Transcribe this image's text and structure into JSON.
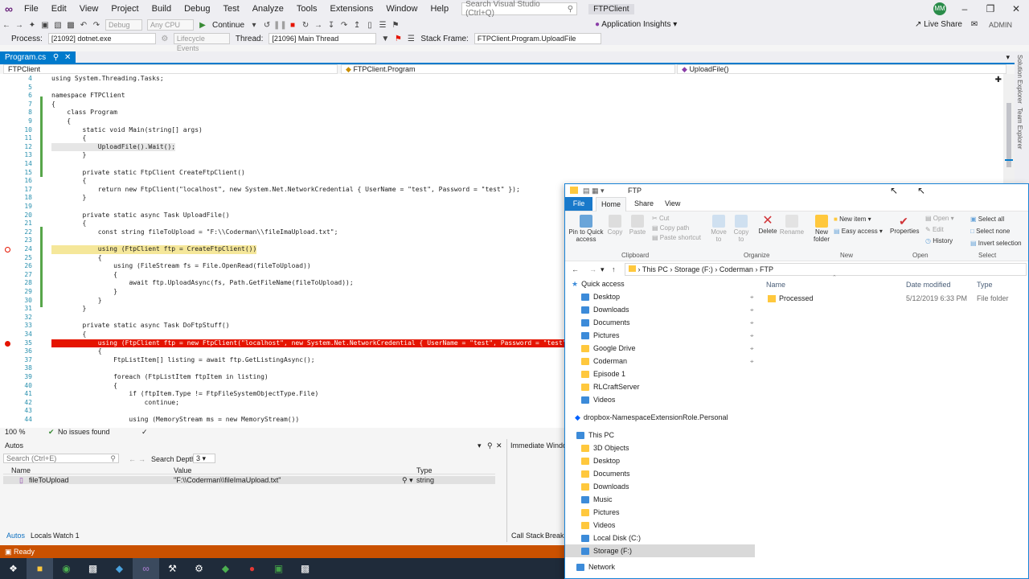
{
  "menubar": {
    "items": [
      "File",
      "Edit",
      "View",
      "Project",
      "Build",
      "Debug",
      "Test",
      "Analyze",
      "Tools",
      "Extensions",
      "Window",
      "Help"
    ],
    "search_placeholder": "Search Visual Studio (Ctrl+Q)",
    "solution_name": "FTPClient",
    "user_initials": "MM"
  },
  "toolbar": {
    "debug_config": "Debug",
    "platform": "Any CPU",
    "continue_label": "Continue",
    "app_insights": "Application Insights",
    "live_share": "Live Share",
    "admin_badge": "ADMIN",
    "process_label": "Process:",
    "process_value": "[21092] dotnet.exe",
    "lifecycle_events": "Lifecycle Events",
    "thread_label": "Thread:",
    "thread_value": "[21096] Main Thread",
    "stack_frame_label": "Stack Frame:",
    "stack_frame_value": "FTPClient.Program.UploadFile"
  },
  "editor": {
    "tab_name": "Program.cs",
    "nav_project": "FTPClient",
    "nav_class": "FTPClient.Program",
    "nav_member": "UploadFile()",
    "zoom": "100 %",
    "issues": "No issues found",
    "lines": [
      {
        "n": "4",
        "text": "using System.Threading.Tasks;"
      },
      {
        "n": "5",
        "text": ""
      },
      {
        "n": "6",
        "text": "namespace FTPClient"
      },
      {
        "n": "7",
        "text": "{"
      },
      {
        "n": "8",
        "text": "    class Program"
      },
      {
        "n": "9",
        "text": "    {"
      },
      {
        "n": "10",
        "text": "        static void Main(string[] args)"
      },
      {
        "n": "11",
        "text": "        {"
      },
      {
        "n": "12",
        "text": "            UploadFile().Wait();"
      },
      {
        "n": "13",
        "text": "        }"
      },
      {
        "n": "14",
        "text": ""
      },
      {
        "n": "15",
        "text": "        private static FtpClient CreateFtpClient()"
      },
      {
        "n": "16",
        "text": "        {"
      },
      {
        "n": "17",
        "text": "            return new FtpClient(\"localhost\", new System.Net.NetworkCredential { UserName = \"test\", Password = \"test\" });"
      },
      {
        "n": "18",
        "text": "        }"
      },
      {
        "n": "19",
        "text": ""
      },
      {
        "n": "20",
        "text": "        private static async Task UploadFile()"
      },
      {
        "n": "21",
        "text": "        {"
      },
      {
        "n": "22",
        "text": "            const string fileToUpload = \"F:\\\\Coderman\\\\fileImaUpload.txt\";"
      },
      {
        "n": "23",
        "text": ""
      },
      {
        "n": "24",
        "text": "            using (FtpClient ftp = CreateFtpClient())"
      },
      {
        "n": "25",
        "text": "            {"
      },
      {
        "n": "26",
        "text": "                using (FileStream fs = File.OpenRead(fileToUpload))"
      },
      {
        "n": "27",
        "text": "                {"
      },
      {
        "n": "28",
        "text": "                    await ftp.UploadAsync(fs, Path.GetFileName(fileToUpload));"
      },
      {
        "n": "29",
        "text": "                }"
      },
      {
        "n": "30",
        "text": "            }"
      },
      {
        "n": "31",
        "text": "        }"
      },
      {
        "n": "32",
        "text": ""
      },
      {
        "n": "33",
        "text": "        private static async Task DoFtpStuff()"
      },
      {
        "n": "34",
        "text": "        {"
      },
      {
        "n": "35",
        "text": "            using (FtpClient ftp = new FtpClient(\"localhost\", new System.Net.NetworkCredential { UserName = \"test\", Password = \"test\" })"
      },
      {
        "n": "36",
        "text": "            {"
      },
      {
        "n": "37",
        "text": "                FtpListItem[] listing = await ftp.GetListingAsync();"
      },
      {
        "n": "38",
        "text": ""
      },
      {
        "n": "39",
        "text": "                foreach (FtpListItem ftpItem in listing)"
      },
      {
        "n": "40",
        "text": "                {"
      },
      {
        "n": "41",
        "text": "                    if (ftpItem.Type != FtpFileSystemObjectType.File)"
      },
      {
        "n": "42",
        "text": "                        continue;"
      },
      {
        "n": "43",
        "text": ""
      },
      {
        "n": "44",
        "text": "                    using (MemoryStream ms = new MemoryStream())"
      }
    ]
  },
  "autos": {
    "title": "Autos",
    "search_placeholder": "Search (Ctrl+E)",
    "search_depth_label": "Search Depth:",
    "search_depth": "3",
    "columns": [
      "Name",
      "Value",
      "Type"
    ],
    "rows": [
      {
        "name": "fileToUpload",
        "value": "\"F:\\\\Coderman\\\\fileImaUpload.txt\"",
        "type": "string"
      }
    ],
    "tabs": [
      "Autos",
      "Locals",
      "Watch 1"
    ]
  },
  "immediate": {
    "title": "Immediate Window",
    "tabs": [
      "Call Stack",
      "Breakp"
    ]
  },
  "statusbar": {
    "text": "Ready"
  },
  "side_tabs": [
    "Solution Explorer",
    "Team Explorer"
  ],
  "explorer": {
    "title": "FTP",
    "tabs": [
      "File",
      "Home",
      "Share",
      "View"
    ],
    "ribbon": {
      "clipboard": [
        "Pin to Quick access",
        "Copy",
        "Paste",
        "Cut",
        "Copy path",
        "Paste shortcut"
      ],
      "organize": [
        "Move to",
        "Copy to",
        "Delete",
        "Rename"
      ],
      "new": [
        "New folder",
        "New item",
        "Easy access"
      ],
      "open": [
        "Properties",
        "Open",
        "Edit",
        "History"
      ],
      "select": [
        "Select all",
        "Select none",
        "Invert selection"
      ],
      "groups": [
        "Clipboard",
        "Organize",
        "New",
        "Open",
        "Select"
      ]
    },
    "path": [
      "This PC",
      "Storage (F:)",
      "Coderman",
      "FTP"
    ],
    "columns": [
      "Name",
      "Date modified",
      "Type"
    ],
    "files": [
      {
        "name": "Processed",
        "date": "5/12/2019 6:33 PM",
        "type": "File folder"
      }
    ],
    "nav": {
      "quick_access": "Quick access",
      "quick_items": [
        "Desktop",
        "Downloads",
        "Documents",
        "Pictures",
        "Google Drive",
        "Coderman",
        "Episode 1",
        "RLCraftServer",
        "Videos"
      ],
      "dropbox": "dropbox-NamespaceExtensionRole.Personal",
      "this_pc": "This PC",
      "pc_items": [
        "3D Objects",
        "Desktop",
        "Documents",
        "Downloads",
        "Music",
        "Pictures",
        "Videos",
        "Local Disk (C:)",
        "Storage (F:)"
      ],
      "network": "Network"
    }
  }
}
